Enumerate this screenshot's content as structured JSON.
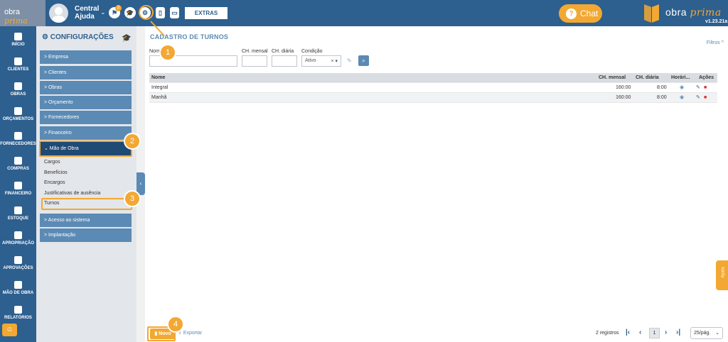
{
  "header": {
    "logo": {
      "text_a": "obra",
      "text_b": "prima"
    },
    "user": {
      "name": "Central Ajuda"
    },
    "notif_count": "2",
    "extras_label": "EXTRAS",
    "chat_label": "Chat",
    "brand": {
      "name_a": "obra",
      "name_b": "prima",
      "version": "v1.23.21a"
    }
  },
  "nav": [
    {
      "label": "INÍCIO",
      "icon": "home-icon"
    },
    {
      "label": "CLIENTES",
      "icon": "user-icon"
    },
    {
      "label": "OBRAS",
      "icon": "buildings-icon"
    },
    {
      "label": "ORÇAMENTOS",
      "icon": "document-dollar-icon"
    },
    {
      "label": "FORNECEDORES",
      "icon": "truck-icon"
    },
    {
      "label": "COMPRAS",
      "icon": "cart-icon"
    },
    {
      "label": "FINANCEIRO",
      "icon": "calculator-icon"
    },
    {
      "label": "ESTOQUE",
      "icon": "boxes-icon"
    },
    {
      "label": "APROPRIAÇÃO",
      "icon": "file-icon"
    },
    {
      "label": "APROVAÇÕES",
      "icon": "checklist-icon"
    },
    {
      "label": "MÃO DE OBRA",
      "icon": "workers-icon"
    },
    {
      "label": "RELATÓRIOS",
      "icon": "report-icon"
    }
  ],
  "config": {
    "title": "CONFIGURAÇÕES",
    "items": [
      {
        "label": "> Empresa"
      },
      {
        "label": "> Clientes"
      },
      {
        "label": "> Obras"
      },
      {
        "label": "> Orçamento"
      },
      {
        "label": "> Fornecedores"
      },
      {
        "label": "> Financeiro"
      },
      {
        "label": "⌄ Mão de Obra"
      }
    ],
    "sub_items": [
      {
        "label": "Cargos"
      },
      {
        "label": "Benefícios"
      },
      {
        "label": "Encargos"
      },
      {
        "label": "Justificativas de ausência"
      },
      {
        "label": "Turnos"
      }
    ],
    "items_after": [
      {
        "label": "> Acesso ao sistema"
      },
      {
        "label": "> Implantação"
      }
    ]
  },
  "main": {
    "title": "CADASTRO DE TURNOS",
    "filters_label": "Filtros",
    "form": {
      "nome_label": "Nome",
      "ch_mensal_label": "CH. mensal",
      "ch_diaria_label": "CH. diária",
      "condicao_label": "Condição",
      "condicao_value": "Ativo"
    },
    "table": {
      "headers": [
        "Nome",
        "CH. mensal",
        "CH. diária",
        "Horári...",
        "Ações"
      ],
      "rows": [
        {
          "nome": "Integral",
          "ch_mensal": "160:00",
          "ch_diaria": "8:00"
        },
        {
          "nome": "Manhã",
          "ch_mensal": "160:00",
          "ch_diaria": "8:00"
        }
      ]
    },
    "footer": {
      "new_label": "Novo",
      "export_label": "Exportar",
      "registros": "2 registros",
      "page": "1",
      "per_page": "25/pág."
    }
  },
  "ajuda_label": "Ajuda",
  "callouts": [
    "1",
    "2",
    "3",
    "4"
  ],
  "colors": {
    "primary": "#2d5f8f",
    "accent": "#f2a832",
    "menu": "#5b8ab4"
  }
}
